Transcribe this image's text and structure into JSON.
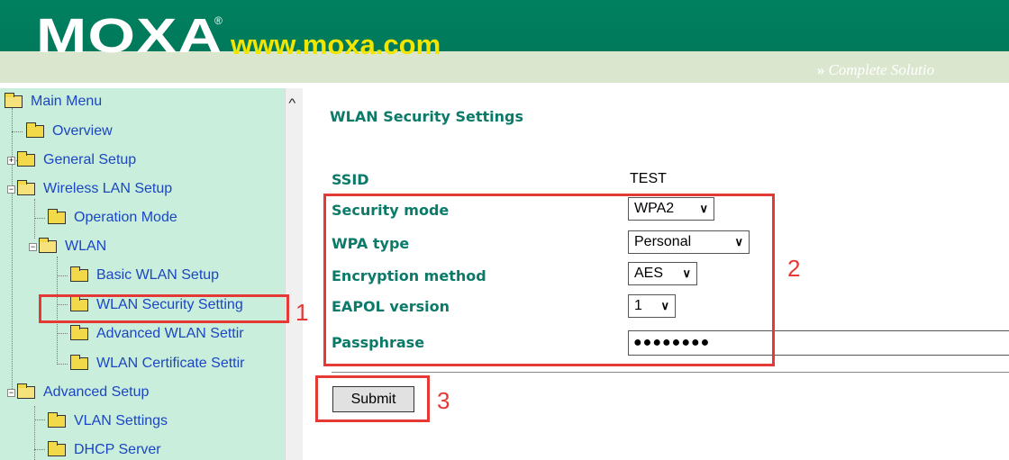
{
  "header": {
    "logo": "MOXA",
    "registered": "®",
    "website": "www.moxa.com",
    "tagline_chevron": "»",
    "tagline": "Complete Solutio"
  },
  "sidebar": {
    "items": [
      {
        "label": "Main Menu",
        "icon": "open-folder-icon"
      },
      {
        "label": "Overview",
        "icon": "folder-icon"
      },
      {
        "label": "General Setup",
        "icon": "folder-icon",
        "expander": "+"
      },
      {
        "label": "Wireless LAN Setup",
        "icon": "open-folder-icon",
        "expander": "−"
      },
      {
        "label": "Operation Mode",
        "icon": "folder-icon"
      },
      {
        "label": "WLAN",
        "icon": "open-folder-icon",
        "expander": "−"
      },
      {
        "label": "Basic WLAN Setup",
        "icon": "folder-icon"
      },
      {
        "label": "WLAN Security Setting",
        "icon": "folder-icon"
      },
      {
        "label": "Advanced WLAN Settir",
        "icon": "folder-icon"
      },
      {
        "label": "WLAN Certificate Settir",
        "icon": "folder-icon"
      },
      {
        "label": "Advanced Setup",
        "icon": "open-folder-icon",
        "expander": "−"
      },
      {
        "label": "VLAN Settings",
        "icon": "folder-icon"
      },
      {
        "label": "DHCP Server",
        "icon": "folder-icon"
      }
    ],
    "scroll_up": "^"
  },
  "main": {
    "title": "WLAN Security Settings",
    "form": {
      "ssid_label": "SSID",
      "ssid_value": "TEST",
      "security_mode_label": "Security mode",
      "security_mode_value": "WPA2",
      "wpa_type_label": "WPA type",
      "wpa_type_value": "Personal",
      "encryption_label": "Encryption method",
      "encryption_value": "AES",
      "eapol_label": "EAPOL version",
      "eapol_value": "1",
      "passphrase_label": "Passphrase",
      "passphrase_value": "●●●●●●●●"
    },
    "submit_label": "Submit"
  },
  "annotations": {
    "n1": "1",
    "n2": "2",
    "n3": "3",
    "color": "#e53935"
  },
  "colors": {
    "header_green": "#007a5a",
    "sidebar_bg": "#c9eedc",
    "label_green": "#0c7a68",
    "link_blue": "#1b46c4",
    "website_yellow": "#f2e600"
  }
}
